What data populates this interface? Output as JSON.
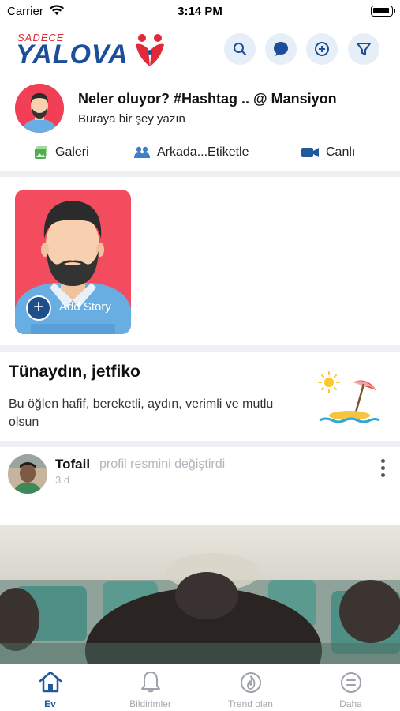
{
  "status_bar": {
    "carrier": "Carrier",
    "time": "3:14 PM"
  },
  "header": {
    "logo_small": "SADECE",
    "logo_main": "YALOVA",
    "buttons": [
      "search-icon",
      "chat-icon",
      "add-icon",
      "filter-icon"
    ]
  },
  "composer": {
    "title": "Neler oluyor? #Hashtag .. @ Mansiyon",
    "placeholder": "Buraya bir şey yazın",
    "actions": [
      {
        "label": "Galeri",
        "icon": "gallery-icon"
      },
      {
        "label": "Arkada...Etiketle",
        "icon": "friends-icon"
      },
      {
        "label": "Canlı",
        "icon": "video-icon"
      }
    ]
  },
  "story": {
    "label": "Add Story"
  },
  "greeting": {
    "title": "Tünaydın, jetfiko",
    "message": "Bu öğlen hafif, bereketli, aydın, verimli ve mutlu olsun"
  },
  "post": {
    "author": "Tofail",
    "action": "profil resmini değiştirdi",
    "time": "3 d"
  },
  "tabbar": {
    "tabs": [
      {
        "label": "Ev",
        "icon": "home-icon",
        "active": true
      },
      {
        "label": "Bildirimler",
        "icon": "bell-icon",
        "active": false
      },
      {
        "label": "Trend olan",
        "icon": "flame-icon",
        "active": false
      },
      {
        "label": "Daha",
        "icon": "menu-icon",
        "active": false
      }
    ]
  },
  "colors": {
    "brand": "#1d4e9c",
    "accent": "#e02a3a",
    "tab_active": "#1e5a9c"
  }
}
